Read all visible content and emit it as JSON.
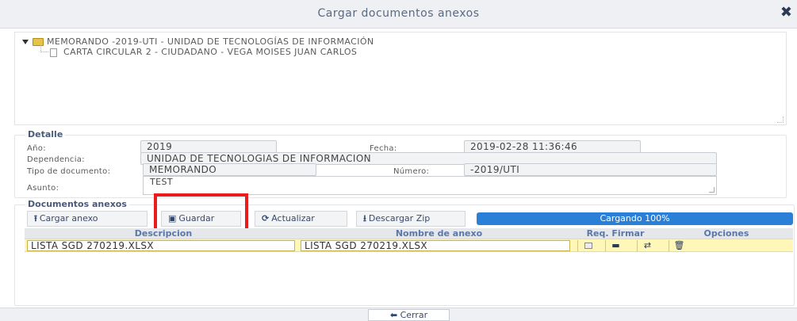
{
  "window": {
    "title": "Cargar documentos anexos",
    "close_icon": "close-icon"
  },
  "tree": {
    "root": "MEMORANDO -2019-UTI - UNIDAD DE TECNOLOGÍAS DE INFORMACIÓN",
    "child": "CARTA CIRCULAR 2 - CIUDADANO - VEGA MOISES JUAN CARLOS"
  },
  "detalle": {
    "legend": "Detalle",
    "anio_label": "Año:",
    "anio_value": "2019",
    "fecha_label": "Fecha:",
    "fecha_value": "2019-02-28 11:36:46",
    "dependencia_label": "Dependencia:",
    "dependencia_value": "UNIDAD DE TECNOLOGIAS DE INFORMACION",
    "tipo_label": "Tipo de documento:",
    "tipo_value": "MEMORANDO",
    "numero_label": "Número:",
    "numero_value": "-2019/UTI",
    "asunto_label": "Asunto:",
    "asunto_value": "TEST"
  },
  "anexos": {
    "legend": "Documentos anexos",
    "btn_cargar": "Cargar anexo",
    "btn_guardar": "Guardar",
    "btn_actualizar": "Actualizar",
    "btn_descargar": "Descargar Zip",
    "progress_text": "Cargando 100%",
    "progress_value": 100,
    "columns": {
      "descripcion": "Descripcion",
      "nombre": "Nombre de anexo",
      "req": "Req. Firmar",
      "opciones": "Opciones"
    },
    "rows": [
      {
        "descripcion": "LISTA SGD 270219.XLSX",
        "nombre": "LISTA SGD 270219.XLSX"
      }
    ]
  },
  "footer": {
    "cerrar": "Cerrar"
  },
  "colors": {
    "highlight": "#e81c1c",
    "progress": "#2a80d6",
    "row": "#fff7b8"
  }
}
